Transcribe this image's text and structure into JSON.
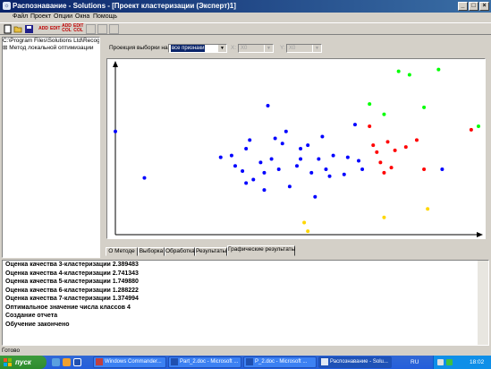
{
  "window": {
    "title": "Распознавание - Solutions - [Проект кластеризации (Эксперт)1]",
    "minimize_glyph": "_",
    "maximize_glyph": "□",
    "close_glyph": "×"
  },
  "menu": [
    "Файл",
    "Проект",
    "Опции",
    "Окна",
    "Помощь"
  ],
  "toolbar": {
    "buttons": [
      {
        "icon": "new-document-icon"
      },
      {
        "icon": "open-folder-icon"
      },
      {
        "icon": "save-icon"
      },
      {
        "label": "ADD",
        "icon": "add-icon"
      },
      {
        "label": "EDIT",
        "icon": "edit-icon"
      },
      {
        "label": "ADD COL",
        "icon": "add-column-icon"
      },
      {
        "label": "EDIT COL",
        "icon": "edit-column-icon"
      },
      {
        "label": "",
        "icon": "disabled-button-icon"
      },
      {
        "label": "",
        "icon": "disabled-button-icon"
      },
      {
        "label": "",
        "icon": "disabled-button-icon"
      }
    ]
  },
  "tree": {
    "root": "C:\\Program Files\\Solutions Ltd\\Recognition",
    "item_prefix": "⊞",
    "item": "Метод локальной оптимизации"
  },
  "projection": {
    "label": "Проекция выборки на:",
    "selected": "все признаки",
    "x_label": "X:",
    "x_value": "X0",
    "y_label": "Y:",
    "y_value": "X0"
  },
  "tabs": [
    {
      "label": "О Методе",
      "active": false
    },
    {
      "label": "Выборка",
      "active": false
    },
    {
      "label": "Обработка",
      "active": false
    },
    {
      "label": "Результаты",
      "active": false
    },
    {
      "label": "Графические результаты",
      "active": true
    }
  ],
  "log": [
    "Оценка качества 3-кластеризации 2.389483",
    "Оценка качества 4-кластеризации 2.741343",
    "Оценка качества 5-кластеризации 1.749880",
    "Оценка качества 6-кластеризации 1.288222",
    "Оценка качества 7-кластеризации 1.374994",
    "Оптимальное значение числа классов 4",
    "Создание отчета",
    "Обучение закончено"
  ],
  "status": "Готово",
  "taskbar": {
    "start": "пуск",
    "tasks": [
      {
        "label": "Windows Commander...",
        "active": false
      },
      {
        "label": "Part_2.doc - Microsoft ...",
        "active": false
      },
      {
        "label": "P_2.doc - Microsoft ...",
        "active": false
      },
      {
        "label": "Распознавание - Solu...",
        "active": true
      }
    ],
    "lang": "RU",
    "clock": "18:02"
  },
  "chart_data": {
    "type": "scatter",
    "title": "",
    "xlabel": "",
    "ylabel": "",
    "xlim": [
      0,
      100
    ],
    "ylim": [
      0,
      100
    ],
    "grid": false,
    "series": [
      {
        "color": "#0000ff",
        "points": [
          [
            0,
            60
          ],
          [
            8,
            33
          ],
          [
            29,
            45
          ],
          [
            32,
            46
          ],
          [
            33,
            40
          ],
          [
            35,
            37
          ],
          [
            36,
            50
          ],
          [
            36,
            30
          ],
          [
            37,
            55
          ],
          [
            38,
            32
          ],
          [
            40,
            42
          ],
          [
            41,
            36
          ],
          [
            42,
            75
          ],
          [
            41,
            26
          ],
          [
            43,
            44
          ],
          [
            44,
            56
          ],
          [
            45,
            38
          ],
          [
            46,
            53
          ],
          [
            47,
            60
          ],
          [
            48,
            28
          ],
          [
            50,
            40
          ],
          [
            51,
            44
          ],
          [
            51,
            50
          ],
          [
            53,
            52
          ],
          [
            54,
            36
          ],
          [
            55,
            22
          ],
          [
            56,
            44
          ],
          [
            57,
            57
          ],
          [
            58,
            38
          ],
          [
            59,
            34
          ],
          [
            60,
            46
          ],
          [
            63,
            35
          ],
          [
            64,
            45
          ],
          [
            66,
            64
          ],
          [
            67,
            43
          ],
          [
            68,
            38
          ],
          [
            90,
            38
          ]
        ]
      },
      {
        "color": "#ff0000",
        "points": [
          [
            70,
            63
          ],
          [
            71,
            52
          ],
          [
            72,
            48
          ],
          [
            73,
            42
          ],
          [
            74,
            36
          ],
          [
            75,
            54
          ],
          [
            76,
            39
          ],
          [
            77,
            49
          ],
          [
            80,
            51
          ],
          [
            83,
            55
          ],
          [
            85,
            38
          ],
          [
            98,
            61
          ]
        ]
      },
      {
        "color": "#00ff00",
        "points": [
          [
            70,
            76
          ],
          [
            74,
            70
          ],
          [
            78,
            95
          ],
          [
            81,
            93
          ],
          [
            85,
            74
          ],
          [
            89,
            96
          ],
          [
            100,
            63
          ]
        ]
      },
      {
        "color": "#ffd700",
        "points": [
          [
            52,
            7
          ],
          [
            53,
            2
          ],
          [
            74,
            10
          ],
          [
            86,
            15
          ]
        ]
      }
    ]
  }
}
